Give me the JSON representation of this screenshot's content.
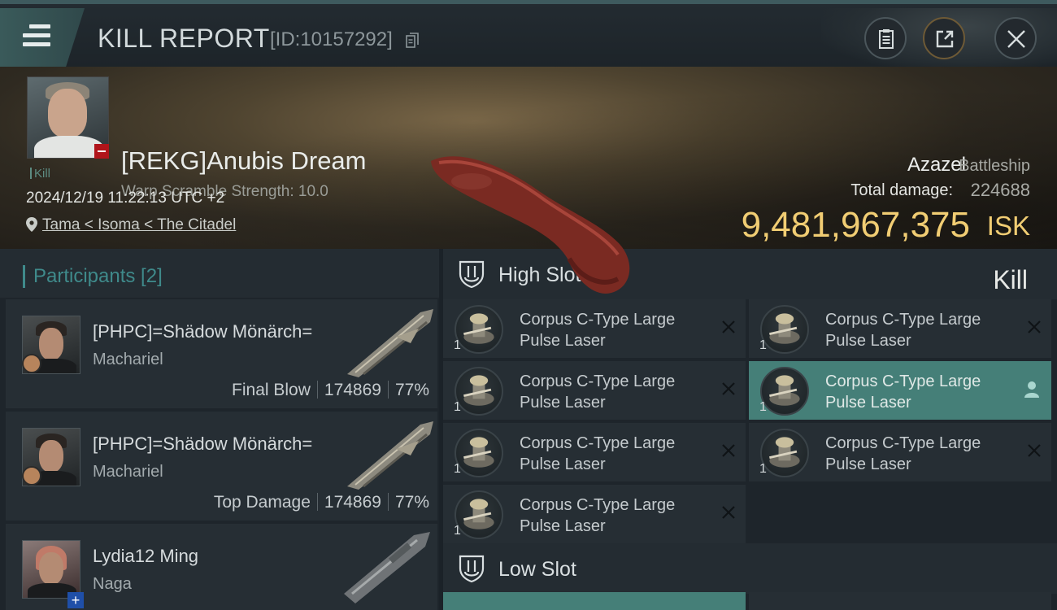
{
  "header": {
    "title": "KILL REPORT",
    "report_id": "[ID:10157292]"
  },
  "victim": {
    "name": "[REKG]Anubis Dream",
    "warp_scramble": "Warp Scramble Strength: 10.0",
    "tag": "Kill",
    "datetime": "2024/12/19 11:22:13 UTC +2",
    "location": "Tama < Isoma < The Citadel",
    "ship_name": "Azazel",
    "ship_class": "Battleship",
    "total_damage_label": "Total damage:",
    "total_damage": "224688",
    "isk_value": "9,481,967,375",
    "isk_unit": "ISK",
    "result": "Kill"
  },
  "participants": {
    "title": "Participants [2]",
    "rows": [
      {
        "name": "[PHPC]=Shädow Mönärch=",
        "ship": "Machariel",
        "role": "Final Blow",
        "damage": "174869",
        "percent": "77%"
      },
      {
        "name": "[PHPC]=Shädow Mönärch=",
        "ship": "Machariel",
        "role": "Top Damage",
        "damage": "174869",
        "percent": "77%"
      },
      {
        "name": "Lydia12 Ming",
        "ship": "Naga"
      }
    ]
  },
  "fitting": {
    "high_slot_label": "High Slot",
    "low_slot_label": "Low Slot",
    "modules": [
      {
        "line1": "Corpus C-Type Large",
        "line2": "Pulse Laser",
        "qty": "1"
      },
      {
        "line1": "Corpus C-Type Large",
        "line2": "Pulse Laser",
        "qty": "1"
      },
      {
        "line1": "Corpus C-Type Large",
        "line2": "Pulse Laser",
        "qty": "1"
      },
      {
        "line1": "Corpus C-Type Large",
        "line2": "Pulse Laser",
        "qty": "1"
      },
      {
        "line1": "Corpus C-Type Large",
        "line2": "Pulse Laser",
        "qty": "1"
      },
      {
        "line1": "Corpus C-Type Large",
        "line2": "Pulse Laser",
        "qty": "1"
      },
      {
        "line1": "Corpus C-Type Large",
        "line2": "Pulse Laser",
        "qty": "1"
      }
    ]
  },
  "colors": {
    "accent_teal": "#3f8a8b",
    "isk_gold": "#f1cd73",
    "selected_row": "#457f78",
    "kill_badge_red": "#b0141a"
  },
  "icons": [
    "menu-icon",
    "copy-icon",
    "clipboard-icon",
    "export-icon",
    "close-icon",
    "location-pin-icon",
    "shield-slot-icon",
    "remove-x-icon",
    "person-icon"
  ]
}
